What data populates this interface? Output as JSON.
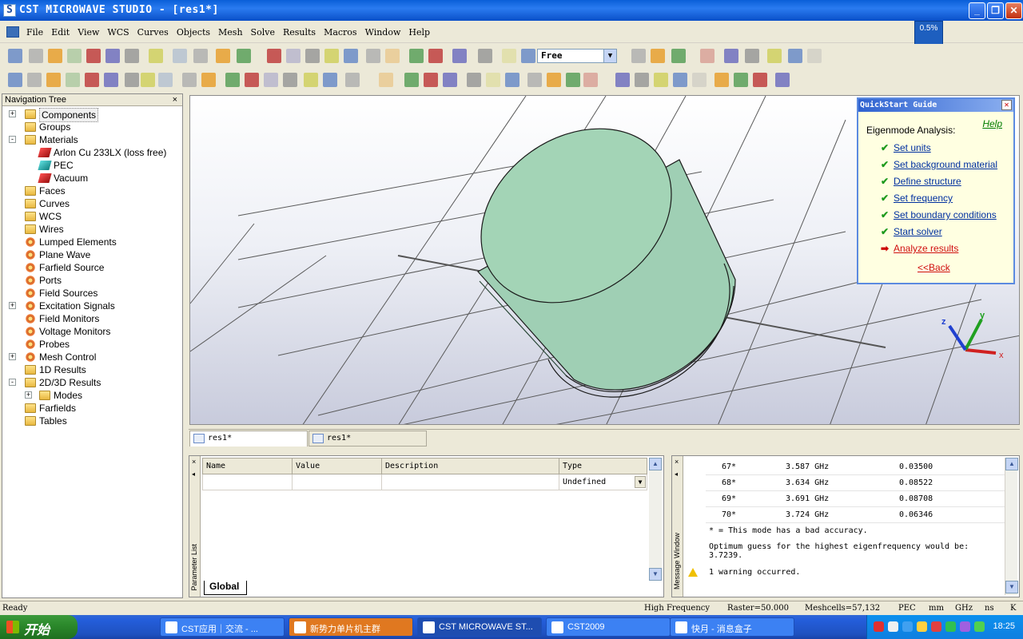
{
  "window": {
    "title": "CST MICROWAVE STUDIO - [res1*]",
    "percent": "0.5%"
  },
  "menu": [
    "File",
    "Edit",
    "View",
    "WCS",
    "Curves",
    "Objects",
    "Mesh",
    "Solve",
    "Results",
    "Macros",
    "Window",
    "Help"
  ],
  "toolbar": {
    "selection_mode": "Free"
  },
  "nav_tree": {
    "title": "Navigation Tree",
    "items": [
      {
        "label": "Components",
        "icon": "folder",
        "expand": "+",
        "indent": 0
      },
      {
        "label": "Groups",
        "icon": "folder",
        "expand": "",
        "indent": 0
      },
      {
        "label": "Materials",
        "icon": "folder",
        "expand": "-",
        "indent": 0
      },
      {
        "label": "Arlon Cu 233LX (loss free)",
        "icon": "material-red",
        "expand": "",
        "indent": 1
      },
      {
        "label": "PEC",
        "icon": "material-cyan",
        "expand": "",
        "indent": 1
      },
      {
        "label": "Vacuum",
        "icon": "material-red",
        "expand": "",
        "indent": 1
      },
      {
        "label": "Faces",
        "icon": "folder",
        "expand": "",
        "indent": 0
      },
      {
        "label": "Curves",
        "icon": "folder",
        "expand": "",
        "indent": 0
      },
      {
        "label": "WCS",
        "icon": "folder",
        "expand": "",
        "indent": 0
      },
      {
        "label": "Wires",
        "icon": "folder",
        "expand": "",
        "indent": 0
      },
      {
        "label": "Lumped Elements",
        "icon": "gear",
        "expand": "",
        "indent": 0
      },
      {
        "label": "Plane Wave",
        "icon": "gear",
        "expand": "",
        "indent": 0
      },
      {
        "label": "Farfield Source",
        "icon": "gear",
        "expand": "",
        "indent": 0
      },
      {
        "label": "Ports",
        "icon": "gear",
        "expand": "",
        "indent": 0
      },
      {
        "label": "Field Sources",
        "icon": "gear",
        "expand": "",
        "indent": 0
      },
      {
        "label": "Excitation Signals",
        "icon": "gear",
        "expand": "+",
        "indent": 0
      },
      {
        "label": "Field Monitors",
        "icon": "gear",
        "expand": "",
        "indent": 0
      },
      {
        "label": "Voltage Monitors",
        "icon": "gear",
        "expand": "",
        "indent": 0
      },
      {
        "label": "Probes",
        "icon": "gear",
        "expand": "",
        "indent": 0
      },
      {
        "label": "Mesh Control",
        "icon": "gear",
        "expand": "+",
        "indent": 0
      },
      {
        "label": "1D Results",
        "icon": "folder",
        "expand": "",
        "indent": 0
      },
      {
        "label": "2D/3D Results",
        "icon": "folder",
        "expand": "-",
        "indent": 0
      },
      {
        "label": "Modes",
        "icon": "folder",
        "expand": "+",
        "indent": 1
      },
      {
        "label": "Farfields",
        "icon": "folder",
        "expand": "",
        "indent": 0
      },
      {
        "label": "Tables",
        "icon": "folder",
        "expand": "",
        "indent": 0
      }
    ]
  },
  "quickstart": {
    "title": "QuickStart Guide",
    "help": "Help",
    "heading": "Eigenmode Analysis:",
    "steps": [
      {
        "label": "Set units",
        "done": true
      },
      {
        "label": "Set background material",
        "done": true
      },
      {
        "label": "Define structure",
        "done": true
      },
      {
        "label": "Set frequency",
        "done": true
      },
      {
        "label": "Set boundary conditions",
        "done": true
      },
      {
        "label": "Start solver",
        "done": true
      },
      {
        "label": "Analyze results",
        "done": false
      }
    ],
    "back": "<<Back"
  },
  "axes": {
    "x": "x",
    "y": "y",
    "z": "z"
  },
  "doc_tabs": [
    "res1*",
    "res1*"
  ],
  "param_list": {
    "side_label": "Parameter List",
    "columns": [
      "Name",
      "Value",
      "Description",
      "Type"
    ],
    "row_type": "Undefined",
    "tab": "Global"
  },
  "message_window": {
    "side_label": "Message Window",
    "modes": [
      {
        "num": "67*",
        "freq": "3.587 GHz",
        "acc": "0.03500"
      },
      {
        "num": "68*",
        "freq": "3.634 GHz",
        "acc": "0.08522"
      },
      {
        "num": "69*",
        "freq": "3.691 GHz",
        "acc": "0.08708"
      },
      {
        "num": "70*",
        "freq": "3.724 GHz",
        "acc": "0.06346"
      }
    ],
    "note": "* = This mode has a bad accuracy.",
    "optimum_line1": "Optimum guess for the highest eigenfrequency would be:",
    "optimum_line2": "3.7239.",
    "warning": "1 warning occurred."
  },
  "status": {
    "ready": "Ready",
    "solver": "High Frequency",
    "raster": "Raster=50.000",
    "meshcells": "Meshcells=57,132",
    "material": "PEC",
    "units1": "mm",
    "freq_unit": "GHz",
    "time_unit": "ns",
    "temp_unit": "K"
  },
  "taskbar": {
    "start": "开始",
    "items": [
      {
        "label": "CST应用｜交流 - ..."
      },
      {
        "label": "新势力单片机主群"
      },
      {
        "label": "CST MICROWAVE ST..."
      },
      {
        "label": "CST2009"
      },
      {
        "label": "快月 - 消息盒子"
      }
    ],
    "clock": "18:25"
  }
}
